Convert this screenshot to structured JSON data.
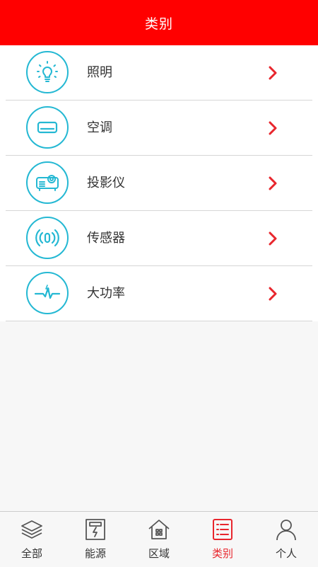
{
  "header": {
    "title": "类别"
  },
  "colors": {
    "header_bg": "#ff0000",
    "icon_stroke": "#24b8d3",
    "chevron": "#e8262d",
    "active_tab": "#e8262d"
  },
  "categories": [
    {
      "label": "照明",
      "icon": "light-bulb-icon"
    },
    {
      "label": "空调",
      "icon": "air-conditioner-icon"
    },
    {
      "label": "投影仪",
      "icon": "projector-icon"
    },
    {
      "label": "传感器",
      "icon": "sensor-icon"
    },
    {
      "label": "大功率",
      "icon": "power-wave-icon"
    }
  ],
  "tabbar": {
    "active": "类别",
    "tabs": [
      {
        "label": "全部",
        "icon": "layers-icon"
      },
      {
        "label": "能源",
        "icon": "energy-meter-icon"
      },
      {
        "label": "区域",
        "icon": "home-icon"
      },
      {
        "label": "类别",
        "icon": "list-icon"
      },
      {
        "label": "个人",
        "icon": "user-icon"
      }
    ]
  }
}
